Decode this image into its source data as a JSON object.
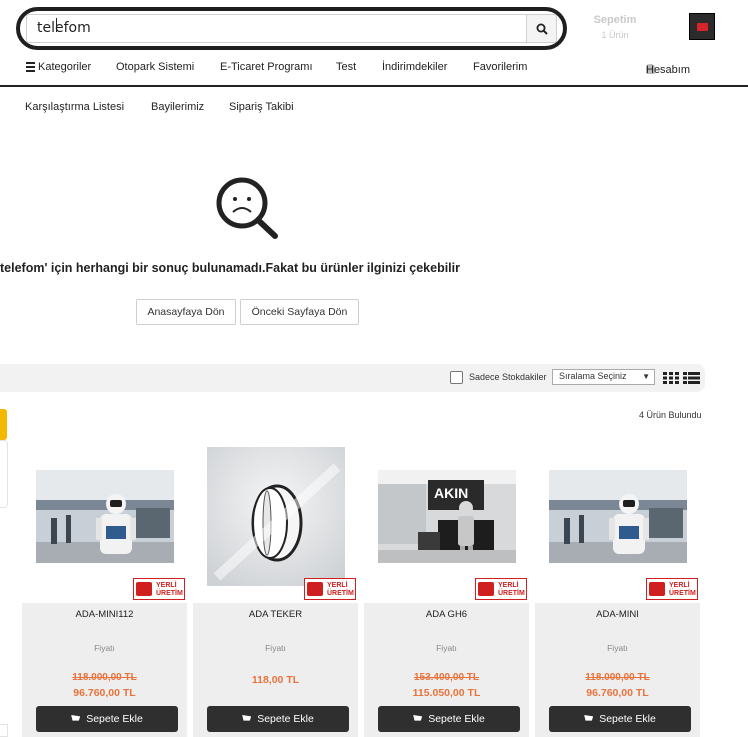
{
  "search": {
    "value": "telefom"
  },
  "cart": {
    "title": "Sepetim",
    "count": "1 Ürün"
  },
  "nav": {
    "categories": "Kategoriler",
    "items": [
      "Otopark Sistemi",
      "E-Ticaret Programı",
      "Test",
      "İndirimdekiler",
      "Favorilerim"
    ],
    "account": "Hesabım"
  },
  "subnav": [
    "Karşılaştırma Listesi",
    "Bayilerimiz",
    "Sipariş Takibi"
  ],
  "empty": {
    "message": "telefom' için herhangi bir sonuç bulunamadı.Fakat bu ürünler ilginizi çekebilir",
    "home_button": "Anasayfaya Dön",
    "back_button": "Önceki Sayfaya Dön"
  },
  "filter": {
    "stock_only": "Sadece Stokdakiler",
    "sort_placeholder": "Sıralama Seçiniz",
    "result_count": "4 Ürün Bulundu"
  },
  "badge": {
    "line1": "YERLİ",
    "line2": "ÜRETİM"
  },
  "products": [
    {
      "name": "ADA-MINI112",
      "price_label": "Fiyatı",
      "old_price": "118.000,00 TL",
      "price": "96.760,00 TL",
      "add_label": "Sepete Ekle"
    },
    {
      "name": "ADA TEKER",
      "price_label": "Fiyatı",
      "old_price": "",
      "price": "118,00 TL",
      "add_label": "Sepete Ekle"
    },
    {
      "name": "ADA GH6",
      "price_label": "Fiyatı",
      "old_price": "153.400,00 TL",
      "price": "115.050,00 TL",
      "add_label": "Sepete Ekle"
    },
    {
      "name": "ADA-MINI",
      "price_label": "Fiyatı",
      "old_price": "118.000,00 TL",
      "price": "96.760,00 TL",
      "add_label": "Sepete Ekle"
    }
  ],
  "colors": {
    "accent_price": "#e8733c",
    "badge_red": "#d01f1f",
    "button_dark": "#2f2f2f",
    "side_tab": "#f5b800"
  }
}
